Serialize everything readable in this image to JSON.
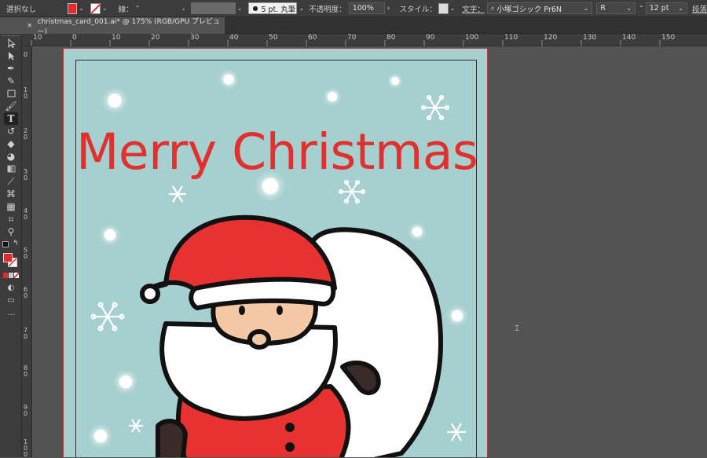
{
  "control_bar": {
    "selection_status": "選択なし",
    "fill_color": "#e8282b",
    "stroke_label": "線：",
    "brush_label": "5 pt. 丸筆",
    "opacity_label": "不透明度：",
    "opacity_value": "100%",
    "style_label": "スタイル：",
    "character_label": "文字：",
    "font_family": "小塚ゴシック Pr6N",
    "font_style": "R",
    "font_size": "12 pt",
    "paragraph_label": "段落"
  },
  "document_tab": {
    "close": "×",
    "title": "christmas_card_001.ai* @ 175% (RGB/GPU プレビュー)"
  },
  "ruler_horizontal": [
    "10",
    "0",
    "10",
    "20",
    "30",
    "40",
    "50",
    "60",
    "70",
    "80",
    "90",
    "100",
    "110",
    "120",
    "130",
    "140",
    "150"
  ],
  "ruler_vertical": [
    "0",
    "1 0",
    "2 0",
    "3 0",
    "4 0",
    "5 0",
    "6 0",
    "7 0",
    "8 0",
    "9 0",
    "1 0 0"
  ],
  "artboard": {
    "headline": "Merry Christmas",
    "headline_color": "#e2302f",
    "background_color": "#a6cfcf"
  },
  "tools": [
    "selection-tool",
    "direct-selection-tool",
    "pen-tool",
    "curvature-tool",
    "rectangle-tool",
    "paintbrush-tool",
    "type-tool",
    "rotate-tool",
    "eraser-tool",
    "shape-builder-tool",
    "gradient-tool",
    "eyedropper-tool",
    "blend-tool",
    "artboard-tool",
    "slice-tool",
    "zoom-tool",
    "fill-stroke-swatch",
    "color-mode",
    "drawing-mode",
    "screen-mode",
    "more-tools"
  ]
}
